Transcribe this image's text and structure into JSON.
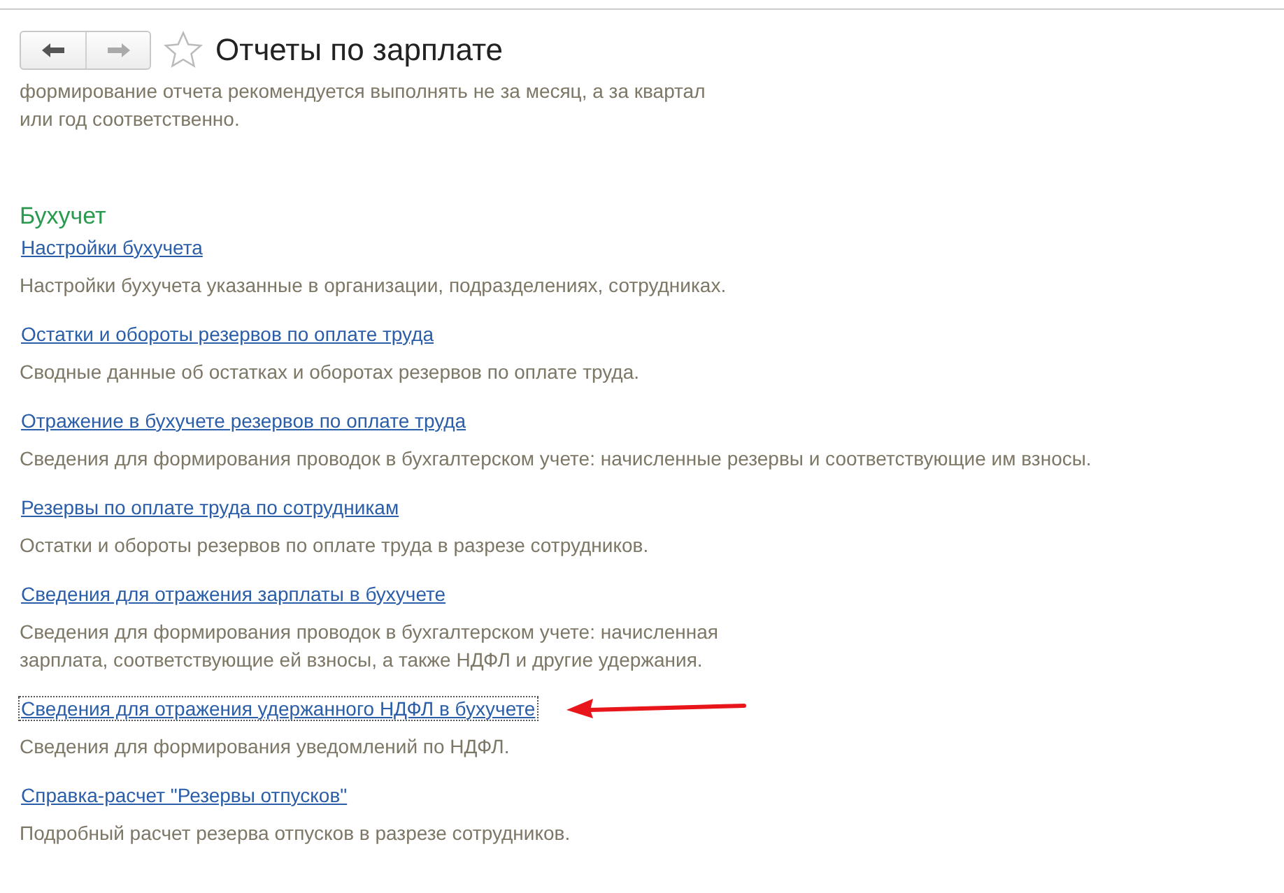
{
  "window": {
    "title": "Отчеты по зарплате",
    "favorite": false
  },
  "intro_lines": [
    "формирование отчета рекомендуется выполнять не за месяц, а за квартал",
    "или год соответственно."
  ],
  "section": {
    "title": "Бухучет",
    "items": [
      {
        "link": "Настройки бухучета",
        "description": [
          "Настройки бухучета указанные в организации, подразделениях, сотрудниках."
        ],
        "focused": false,
        "annotated": false
      },
      {
        "link": "Остатки и обороты резервов по оплате труда",
        "description": [
          "Сводные данные об остатках и оборотах резервов по оплате труда."
        ],
        "focused": false,
        "annotated": false
      },
      {
        "link": "Отражение в бухучете резервов по оплате труда",
        "description": [
          "Сведения для формирования проводок в бухгалтерском учете: начисленные резервы и соответствующие им взносы."
        ],
        "focused": false,
        "annotated": false
      },
      {
        "link": "Резервы по оплате труда по сотрудникам",
        "description": [
          "Остатки и обороты резервов по оплате труда в разрезе сотрудников."
        ],
        "focused": false,
        "annotated": false
      },
      {
        "link": "Сведения для отражения зарплаты в бухучете",
        "description": [
          "Сведения для формирования проводок в бухгалтерском учете: начисленная",
          "зарплата, соответствующие ей взносы, а также НДФЛ и другие удержания."
        ],
        "focused": false,
        "annotated": false
      },
      {
        "link": "Сведения для отражения удержанного НДФЛ в бухучете",
        "description": [
          "Сведения для формирования уведомлений по НДФЛ."
        ],
        "focused": true,
        "annotated": true
      },
      {
        "link": "Справка-расчет \"Резервы отпусков\"",
        "description": [
          "Подробный расчет резерва отпусков в разрезе сотрудников."
        ],
        "focused": false,
        "annotated": false
      }
    ]
  }
}
